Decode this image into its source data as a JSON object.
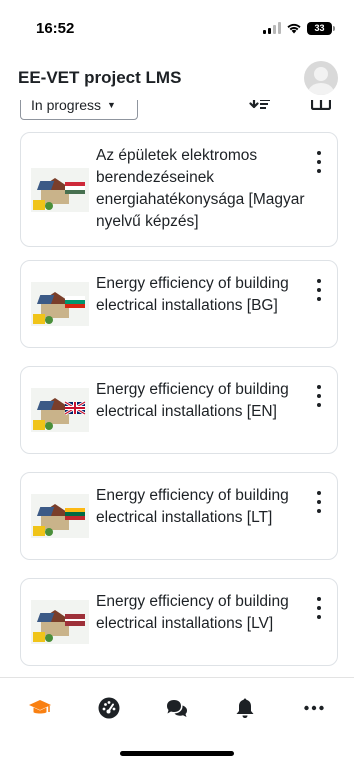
{
  "status_bar": {
    "time": "16:52",
    "battery": "33"
  },
  "header": {
    "title": "EE-VET project LMS",
    "avatar_icon": "user-avatar-icon"
  },
  "filter": {
    "selected": "In progress",
    "sort_icon": "sort-icon",
    "view_icon": "grid-view-icon"
  },
  "courses": [
    {
      "title": "Az épületek elektromos berendezéseinek energiahatékonysága [Magyar nyelvű képzés]",
      "flag": "hu"
    },
    {
      "title": "Energy efficiency of building electrical installations [BG]",
      "flag": "bg"
    },
    {
      "title": "Energy efficiency of building electrical installations [EN]",
      "flag": "en"
    },
    {
      "title": "Energy efficiency of building electrical installations [LT]",
      "flag": "lt"
    },
    {
      "title": "Energy efficiency of building electrical installations [LV]",
      "flag": "lv"
    }
  ],
  "tabs": [
    {
      "icon": "graduation-cap-icon",
      "active": true
    },
    {
      "icon": "dashboard-icon",
      "active": false
    },
    {
      "icon": "messages-icon",
      "active": false
    },
    {
      "icon": "bell-icon",
      "active": false
    },
    {
      "icon": "more-icon",
      "active": false
    }
  ],
  "colors": {
    "accent": "#f98012",
    "text": "#1d2125",
    "border": "#dee2e6"
  }
}
